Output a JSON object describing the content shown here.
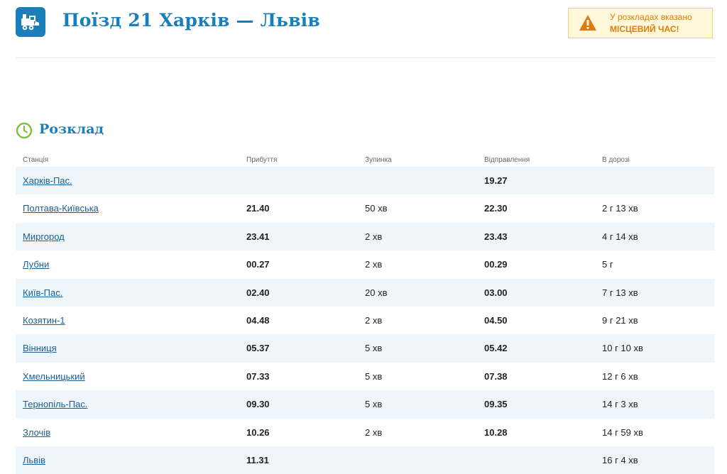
{
  "header": {
    "title": "Поїзд 21 Харків — Львів",
    "logo_icon": "train-icon",
    "notice": {
      "line1": "У розкладах вказано",
      "line2": "МІСЦЕВИЙ ЧАС!",
      "icon": "warning-icon"
    }
  },
  "section": {
    "title": "Розклад",
    "icon": "clock-icon"
  },
  "table": {
    "columns": [
      "Станція",
      "Прибуття",
      "Зупинка",
      "Відправлення",
      "В дорозі"
    ],
    "rows": [
      {
        "station": "Харків-Пас.",
        "arrival": "",
        "stop": "",
        "departure": "19.27",
        "travel": ""
      },
      {
        "station": "Полтава-Київська",
        "arrival": "21.40",
        "stop": "50 хв",
        "departure": "22.30",
        "travel": "2 г  13 хв"
      },
      {
        "station": "Миргород",
        "arrival": "23.41",
        "stop": "2 хв",
        "departure": "23.43",
        "travel": "4 г  14 хв"
      },
      {
        "station": "Лубни",
        "arrival": "00.27",
        "stop": "2 хв",
        "departure": "00.29",
        "travel": "5 г"
      },
      {
        "station": "Київ-Пас.",
        "arrival": "02.40",
        "stop": "20 хв",
        "departure": "03.00",
        "travel": "7 г  13 хв"
      },
      {
        "station": "Козятин-1",
        "arrival": "04.48",
        "stop": "2 хв",
        "departure": "04.50",
        "travel": "9 г  21 хв"
      },
      {
        "station": "Вінниця",
        "arrival": "05.37",
        "stop": "5 хв",
        "departure": "05.42",
        "travel": "10 г  10 хв"
      },
      {
        "station": "Хмельницький",
        "arrival": "07.33",
        "stop": "5 хв",
        "departure": "07.38",
        "travel": "12 г  6 хв"
      },
      {
        "station": "Тернопіль-Пас.",
        "arrival": "09.30",
        "stop": "5 хв",
        "departure": "09.35",
        "travel": "14 г  3 хв"
      },
      {
        "station": "Злочів",
        "arrival": "10.26",
        "stop": "2 хв",
        "departure": "10.28",
        "travel": "14 г  59 хв"
      },
      {
        "station": "Львів",
        "arrival": "11.31",
        "stop": "",
        "departure": "",
        "travel": "16 г  4 хв"
      }
    ]
  },
  "colors": {
    "accent": "#1a7fb8",
    "link": "#1a5f97",
    "row_stripe": "#eef5fb",
    "warning": "#e07b12",
    "notice_bg": "#fff8d9",
    "clock": "#7bbf3a"
  }
}
